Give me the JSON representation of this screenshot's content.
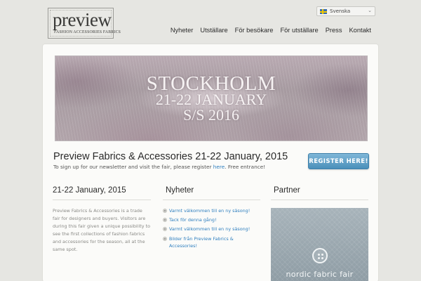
{
  "header": {
    "logo_word": "preview",
    "logo_tagline": "FASHION  ACCESSORIES  FABRICS",
    "language": {
      "selected": "Svenska",
      "flag_icon": "swedish-flag-icon"
    },
    "nav": [
      "Nyheter",
      "Utställare",
      "För besökare",
      "För utställare",
      "Press",
      "Kontakt"
    ]
  },
  "banner": {
    "line1": "STOCKHOLM",
    "line2": "21-22 JANUARY",
    "line3": "S/S 2016"
  },
  "intro": {
    "headline": "Preview Fabrics & Accessories 21-22 January, 2015",
    "text_before": "To sign up for our newsletter and visit the fair, please register ",
    "link": "here",
    "text_after": ". Free entrance!",
    "register_button": "REGISTER HERE!"
  },
  "columns": {
    "about": {
      "title": "21-22 January, 2015",
      "text": "Preview Fabrics & Accessories is a trade fair for designers and buyers. Visitors are during this fair given a unique possibility to see the first collections of fashion fabrics and accessories for the season, all at the same spot."
    },
    "news": {
      "title": "Nyheter",
      "items": [
        "Varmt välkommen till en ny säsong!",
        "Tack för denna gång!",
        "Varmt välkommen till en ny säsong!",
        "Bilder från Preview Fabrics & Accessories!"
      ]
    },
    "partner": {
      "title": "Partner",
      "caption": "nordic fabric fair"
    }
  },
  "colors": {
    "background": "#e6e6e2",
    "panel": "#fbfbf9",
    "link": "#2f7fbf",
    "register_button": "#5a9bc6"
  }
}
